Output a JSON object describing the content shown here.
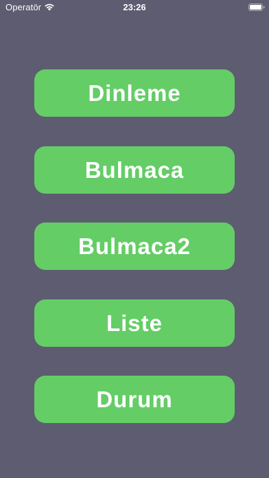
{
  "status_bar": {
    "carrier": "Operatör",
    "time": "23:26",
    "icons": [
      "wifi-icon",
      "battery-icon"
    ]
  },
  "colors": {
    "background": "#5d5c70",
    "button": "#64cd66",
    "button_text": "#ffffff"
  },
  "menu": {
    "buttons": [
      {
        "label": "Dinleme"
      },
      {
        "label": "Bulmaca"
      },
      {
        "label": "Bulmaca2"
      },
      {
        "label": "Liste"
      },
      {
        "label": "Durum"
      }
    ]
  }
}
